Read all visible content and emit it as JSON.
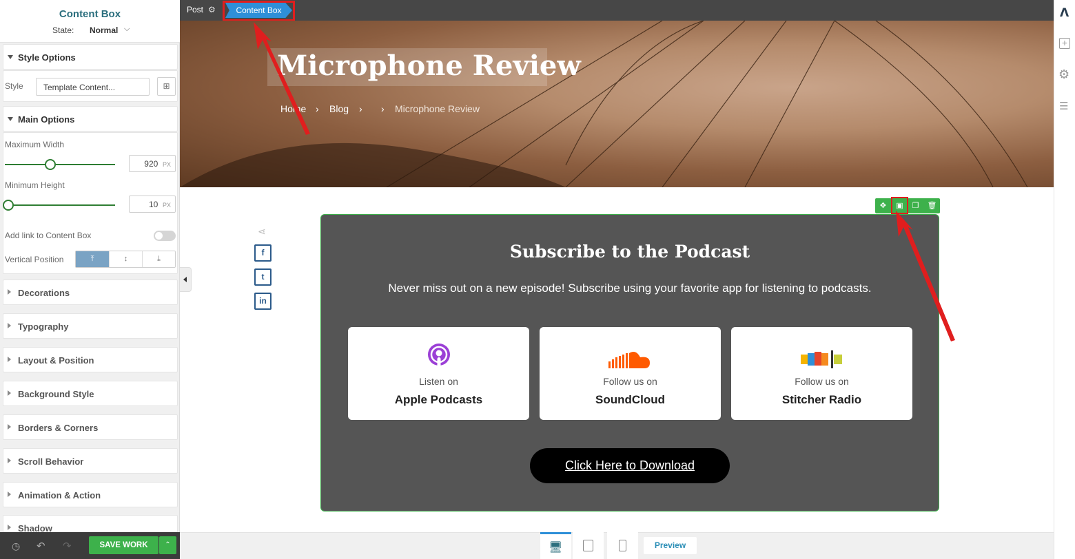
{
  "panel": {
    "title": "Content Box",
    "state_label": "State:",
    "state_value": "Normal",
    "style_options": {
      "header": "Style Options",
      "style_label": "Style",
      "style_value": "Template Content..."
    },
    "main_options": {
      "header": "Main Options",
      "max_width_label": "Maximum Width",
      "max_width_value": "920",
      "max_width_unit": "PX",
      "max_width_slider": 0.4,
      "min_height_label": "Minimum Height",
      "min_height_value": "10",
      "min_height_unit": "PX",
      "min_height_slider": 0.02,
      "add_link_label": "Add link to Content Box",
      "add_link_enabled": false,
      "vertical_position_label": "Vertical Position",
      "vertical_position_selected": "top"
    },
    "sections": [
      {
        "label": "Decorations"
      },
      {
        "label": "Typography"
      },
      {
        "label": "Layout & Position"
      },
      {
        "label": "Background Style"
      },
      {
        "label": "Borders & Corners"
      },
      {
        "label": "Scroll Behavior"
      },
      {
        "label": "Animation & Action"
      },
      {
        "label": "Shadow"
      }
    ],
    "save_label": "SAVE WORK"
  },
  "topbar": {
    "post_label": "Post",
    "breadcrumb_active": "Content Box"
  },
  "hero": {
    "title": "Microphone Review",
    "breadcrumbs": [
      "Home",
      "Blog",
      "Microphone Review"
    ],
    "separator": "›"
  },
  "social": [
    "f",
    "t",
    "in"
  ],
  "content_box": {
    "title": "Subscribe to the Podcast",
    "subtitle": "Never miss out on a new episode! Subscribe using your favorite app for listening to podcasts.",
    "cards": [
      {
        "small": "Listen on",
        "big": "Apple Podcasts",
        "icon": "apple-podcasts-icon"
      },
      {
        "small": "Follow us on",
        "big": "SoundCloud",
        "icon": "soundcloud-icon"
      },
      {
        "small": "Follow us on",
        "big": "Stitcher Radio",
        "icon": "stitcher-icon"
      }
    ],
    "button_label": "Click Here to Download"
  },
  "bottom": {
    "preview_label": "Preview"
  },
  "colors": {
    "accent_green": "#3db14b",
    "breadcrumb_blue": "#2e8fd8",
    "annotation_red": "#e01e1e",
    "content_bg": "#555555"
  }
}
